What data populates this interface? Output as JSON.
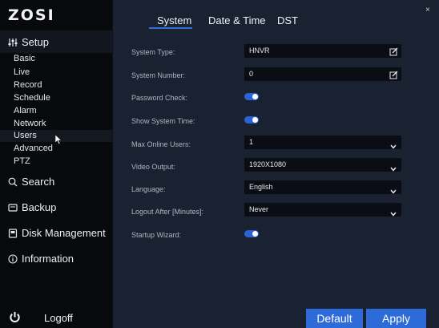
{
  "brand": {
    "logo": "ZOSI"
  },
  "sidebar": {
    "setup_label": "Setup",
    "sub_items": [
      "Basic",
      "Live",
      "Record",
      "Schedule",
      "Alarm",
      "Network",
      "Users",
      "Advanced",
      "PTZ"
    ],
    "search_label": "Search",
    "backup_label": "Backup",
    "disk_label": "Disk Management",
    "info_label": "Information",
    "logoff_label": "Logoff"
  },
  "tabs": [
    "System",
    "Date & Time",
    "DST"
  ],
  "active_tab": "System",
  "form": {
    "system_type": {
      "label": "System Type:",
      "value": "HNVR"
    },
    "system_number": {
      "label": "System Number:",
      "value": "0"
    },
    "password_check": {
      "label": "Password Check:",
      "enabled": true
    },
    "show_system_time": {
      "label": "Show System Time:",
      "enabled": true
    },
    "max_online_users": {
      "label": "Max Online Users:",
      "value": "1"
    },
    "video_output": {
      "label": "Video Output:",
      "value": "1920X1080"
    },
    "language": {
      "label": "Language:",
      "value": "English"
    },
    "logout_after": {
      "label": "Logout After [Minutes]:",
      "value": "Never"
    },
    "startup_wizard": {
      "label": "Startup Wizard:",
      "enabled": true
    }
  },
  "buttons": {
    "default_label": "Default",
    "apply_label": "Apply"
  },
  "close_glyph": "×",
  "colors": {
    "accent": "#2d6bd8",
    "sidebar_bg": "#07090d",
    "content_bg": "#1a2231",
    "field_bg": "#0a0d13"
  }
}
